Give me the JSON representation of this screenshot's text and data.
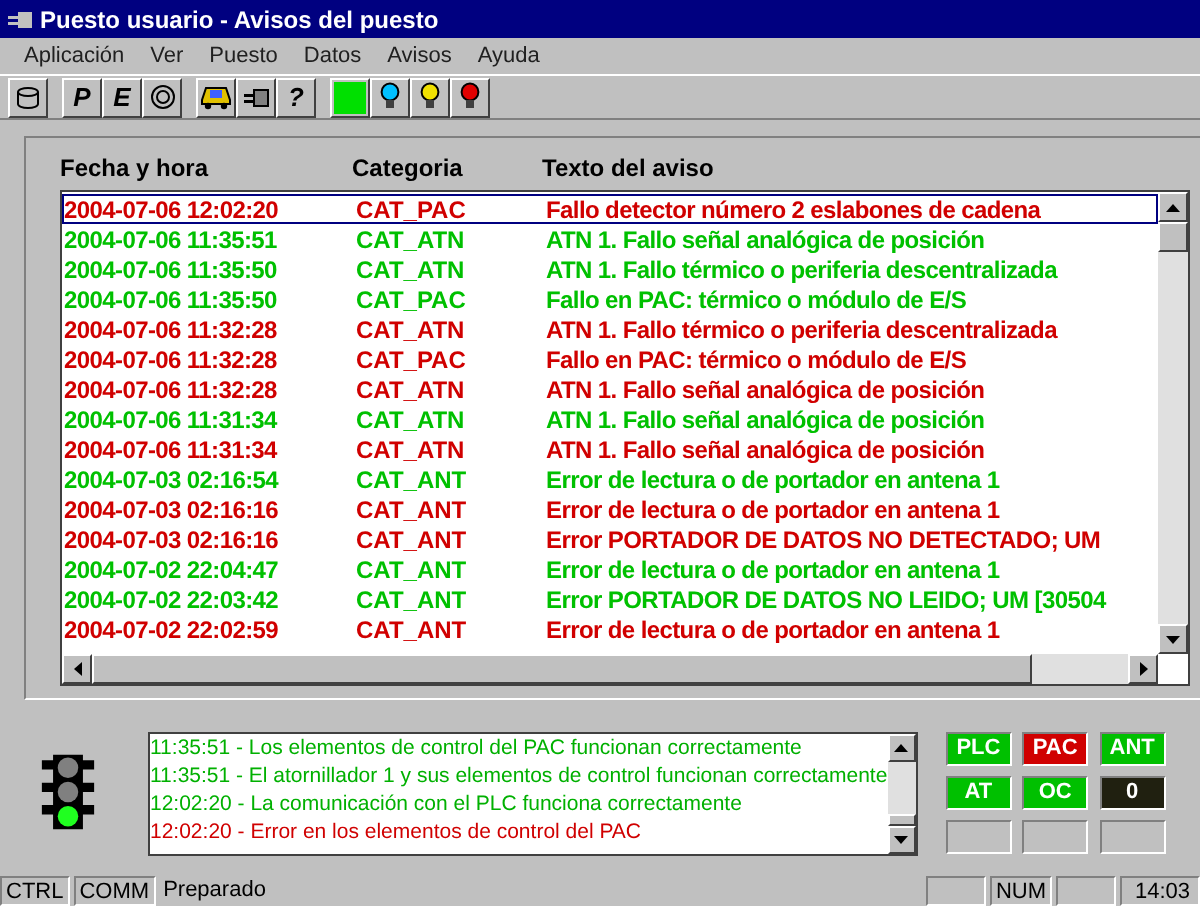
{
  "window": {
    "title": "Puesto usuario - Avisos del puesto"
  },
  "menu": [
    {
      "label": "Aplicación"
    },
    {
      "label": "Ver"
    },
    {
      "label": "Puesto"
    },
    {
      "label": "Datos"
    },
    {
      "label": "Avisos"
    },
    {
      "label": "Ayuda"
    }
  ],
  "toolbar": [
    [
      {
        "kind": "database"
      }
    ],
    [
      {
        "kind": "letter",
        "label": "P"
      },
      {
        "kind": "letter",
        "label": "E"
      },
      {
        "kind": "gear"
      }
    ],
    [
      {
        "kind": "car"
      },
      {
        "kind": "plug"
      },
      {
        "kind": "letter",
        "label": "?"
      }
    ],
    [
      {
        "kind": "square",
        "color": "#00e000"
      },
      {
        "kind": "bulb",
        "color": "#00c0ff"
      },
      {
        "kind": "bulb",
        "color": "#f0e000"
      },
      {
        "kind": "bulb",
        "color": "#e00000"
      }
    ]
  ],
  "table": {
    "columns": [
      "Fecha y hora",
      "Categoria",
      "Texto del aviso"
    ],
    "rows": [
      {
        "date": "2004-07-06 12:02:20",
        "category": "CAT_PAC",
        "text": "Fallo detector número 2 eslabones de cadena",
        "color": "#d00000",
        "selected": true
      },
      {
        "date": "2004-07-06 11:35:51",
        "category": "CAT_ATN",
        "text": "ATN 1. Fallo señal analógica de posición",
        "color": "#00c000",
        "selected": false
      },
      {
        "date": "2004-07-06 11:35:50",
        "category": "CAT_ATN",
        "text": "ATN 1. Fallo térmico o periferia descentralizada",
        "color": "#00c000",
        "selected": false
      },
      {
        "date": "2004-07-06 11:35:50",
        "category": "CAT_PAC",
        "text": "Fallo en PAC: térmico o módulo de E/S",
        "color": "#00c000",
        "selected": false
      },
      {
        "date": "2004-07-06 11:32:28",
        "category": "CAT_ATN",
        "text": "ATN 1. Fallo térmico o periferia descentralizada",
        "color": "#d00000",
        "selected": false
      },
      {
        "date": "2004-07-06 11:32:28",
        "category": "CAT_PAC",
        "text": "Fallo en PAC: térmico o módulo de E/S",
        "color": "#d00000",
        "selected": false
      },
      {
        "date": "2004-07-06 11:32:28",
        "category": "CAT_ATN",
        "text": "ATN 1. Fallo señal analógica de posición",
        "color": "#d00000",
        "selected": false
      },
      {
        "date": "2004-07-06 11:31:34",
        "category": "CAT_ATN",
        "text": "ATN 1. Fallo señal analógica de posición",
        "color": "#00c000",
        "selected": false
      },
      {
        "date": "2004-07-06 11:31:34",
        "category": "CAT_ATN",
        "text": "ATN 1. Fallo señal analógica de posición",
        "color": "#d00000",
        "selected": false
      },
      {
        "date": "2004-07-03 02:16:54",
        "category": "CAT_ANT",
        "text": "Error de lectura o de portador en antena 1",
        "color": "#00c000",
        "selected": false
      },
      {
        "date": "2004-07-03 02:16:16",
        "category": "CAT_ANT",
        "text": "Error de lectura o de portador en antena 1",
        "color": "#d00000",
        "selected": false
      },
      {
        "date": "2004-07-03 02:16:16",
        "category": "CAT_ANT",
        "text": "Error PORTADOR DE DATOS NO DETECTADO; UM",
        "color": "#d00000",
        "selected": false
      },
      {
        "date": "2004-07-02 22:04:47",
        "category": "CAT_ANT",
        "text": "Error de lectura o de portador en antena 1",
        "color": "#00c000",
        "selected": false
      },
      {
        "date": "2004-07-02 22:03:42",
        "category": "CAT_ANT",
        "text": "Error PORTADOR DE DATOS NO LEIDO; UM [30504",
        "color": "#00c000",
        "selected": false
      },
      {
        "date": "2004-07-02 22:02:59",
        "category": "CAT_ANT",
        "text": "Error de lectura o de portador en antena 1",
        "color": "#d00000",
        "selected": false
      }
    ]
  },
  "traffic_light": {
    "lamps": [
      {
        "on": false
      },
      {
        "on": false
      },
      {
        "on": true
      }
    ]
  },
  "log": [
    {
      "text": "11:35:51 - Los elementos de control del PAC funcionan correctamente",
      "color": "#00b000"
    },
    {
      "text": "11:35:51 - El atornillador 1 y sus elementos de control funcionan correctamente",
      "color": "#00b000"
    },
    {
      "text": "12:02:20 - La comunicación con el PLC funciona correctamente",
      "color": "#00b000"
    },
    {
      "text": "12:02:20 - Error en los elementos de control del PAC",
      "color": "#d00000"
    }
  ],
  "indicators": [
    {
      "kind": "lamp",
      "label": "PLC",
      "color": "#00c000"
    },
    {
      "kind": "lamp",
      "label": "PAC",
      "color": "#d00000"
    },
    {
      "kind": "lamp",
      "label": "ANT",
      "color": "#00c000"
    },
    {
      "kind": "lamp",
      "label": "AT",
      "color": "#00c000"
    },
    {
      "kind": "lamp",
      "label": "OC",
      "color": "#00c000"
    },
    {
      "kind": "lamp",
      "label": "0",
      "color": "#202010"
    },
    {
      "kind": "empty"
    },
    {
      "kind": "empty"
    },
    {
      "kind": "empty"
    }
  ],
  "status_bar": [
    {
      "kind": "text",
      "text": "CTRL"
    },
    {
      "kind": "text",
      "text": "COMM"
    },
    {
      "kind": "message",
      "text": "Preparado"
    },
    {
      "kind": "empty"
    },
    {
      "kind": "text",
      "text": "NUM"
    },
    {
      "kind": "empty"
    },
    {
      "kind": "text",
      "text": "14:03"
    }
  ]
}
